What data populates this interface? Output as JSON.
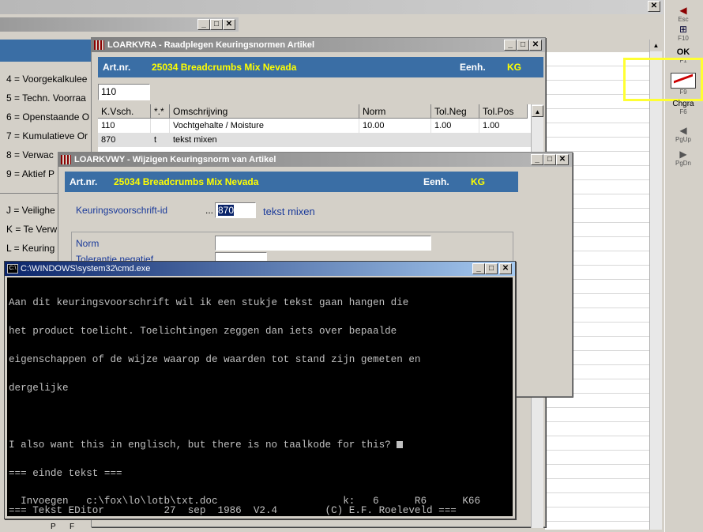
{
  "left_menu": {
    "items_top": [
      "4 = Voorgekalkulee",
      "5 = Techn. Voorraa",
      "6 = Openstaande O",
      "7 = Kumulatieve Or",
      "8 = Verwac",
      "9 = Aktief P"
    ],
    "items_bottom": [
      "J = Veilighe",
      "K = Te Verw",
      "L = Keuring"
    ],
    "bottom_letters": [
      "P",
      "F"
    ]
  },
  "toolbar": {
    "esc": "Esc",
    "f10": "F10",
    "ok": "OK",
    "f1": "F1",
    "f9": "F9",
    "chgra": "Chgra",
    "f6": "F6",
    "pgup": "PgUp",
    "pgdn": "PgDn"
  },
  "win_view": {
    "title": "LOARKVRA - Raadplegen Keuringsnormen Artikel",
    "art_label": "Art.nr.",
    "art_value": "25034  Breadcrumbs Mix Nevada",
    "eenh_label": "Eenh.",
    "eenh_value": "KG",
    "input_value": "110",
    "columns": [
      "K.Vsch.",
      "*.*",
      "Omschrijving",
      "Norm",
      "Tol.Neg",
      "Tol.Pos"
    ],
    "rows": [
      [
        "110",
        "",
        "Vochtgehalte / Moisture",
        "10.00",
        "1.00",
        "1.00"
      ],
      [
        "870",
        "t",
        "tekst mixen",
        "",
        "",
        ""
      ]
    ]
  },
  "win_edit": {
    "title": "LOARKVWY - Wijzigen Keuringsnorm van Artikel",
    "art_label": "Art.nr.",
    "art_value": "25034  Breadcrumbs Mix Nevada",
    "eenh_label": "Eenh.",
    "eenh_value": "KG",
    "keur_label": "Keuringsvoorschrift-id",
    "keur_dots": "...",
    "keur_value": "870",
    "keur_desc": "tekst mixen",
    "norm_label": "Norm",
    "tol_label": "Tolerantie negatief"
  },
  "cmd": {
    "title": "C:\\WINDOWS\\system32\\cmd.exe",
    "lines": [
      "Aan dit keuringsvoorschrift wil ik een stukje tekst gaan hangen die",
      "het product toelicht. Toelichtingen zeggen dan iets over bepaalde",
      "eigenschappen of de wijze waarop de waarden tot stand zijn gemeten en",
      "dergelijke",
      "",
      "I also want this in englisch, but there is no taalkode for this? ",
      "=== einde tekst ==="
    ],
    "status1": "  Invoegen   c:\\fox\\lo\\lotb\\txt.doc                     k:   6      R6      K66",
    "status2": "=== Tekst EDitor          27  sep  1986  V2.4        (C) E.F. Roeleveld ==="
  }
}
